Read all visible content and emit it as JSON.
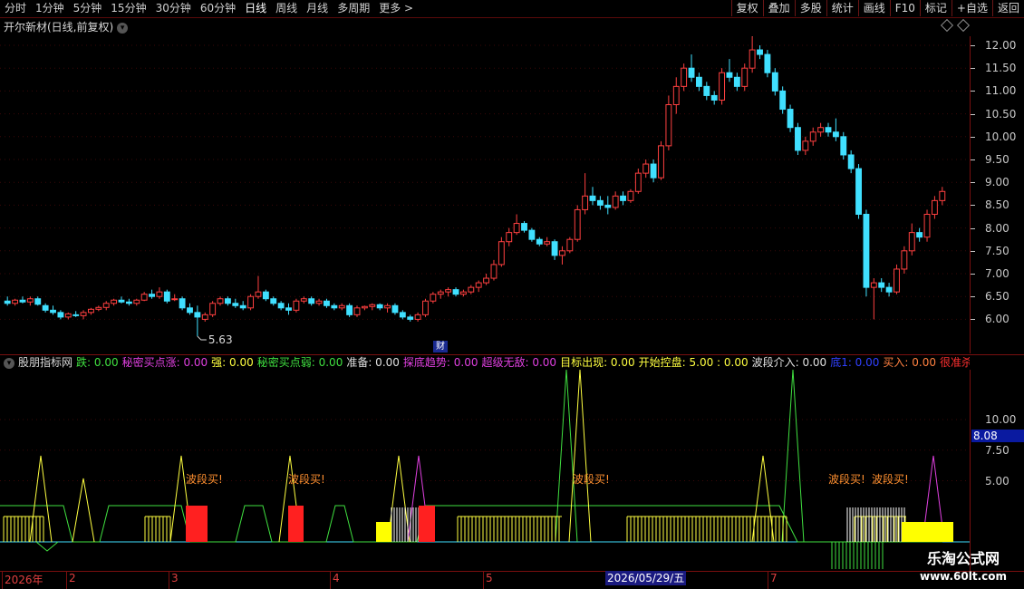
{
  "toolbar": {
    "periods": [
      "分时",
      "1分钟",
      "5分钟",
      "15分钟",
      "30分钟",
      "60分钟",
      "日线",
      "周线",
      "月线",
      "多周期",
      "更多 >"
    ],
    "active_period": "日线",
    "buttons": [
      "复权",
      "叠加",
      "多股",
      "统计",
      "画线",
      "F10",
      "标记",
      "+自选",
      "返回"
    ]
  },
  "title": "开尔新材(日线,前复权)",
  "price_axis": {
    "ticks": [
      "12.00",
      "11.50",
      "11.00",
      "10.50",
      "10.00",
      "9.50",
      "9.00",
      "8.50",
      "8.00",
      "7.50",
      "7.00",
      "6.50",
      "6.00"
    ],
    "values": [
      12.0,
      11.5,
      11.0,
      10.5,
      10.0,
      9.5,
      9.0,
      8.5,
      8.0,
      7.5,
      7.0,
      6.5,
      6.0
    ],
    "max_label": "12.20",
    "min_label": "5.63",
    "cai": "财"
  },
  "indicator": {
    "name": "股朋指标网",
    "items": [
      {
        "label": "跌",
        "value": "0.00",
        "color": "#40e040"
      },
      {
        "label": "秘密买点涨",
        "value": "0.00",
        "color": "#e040e0"
      },
      {
        "label": "强",
        "value": "0.00",
        "color": "#ffff40"
      },
      {
        "label": "秘密买点弱",
        "value": "0.00",
        "color": "#40e040"
      },
      {
        "label": "准备",
        "value": "0.00",
        "color": "#e0e0e0"
      },
      {
        "label": "探底趋势",
        "value": "0.00",
        "color": "#e040e0"
      },
      {
        "label": "超级无敌",
        "value": "0.00",
        "color": "#e040e0"
      },
      {
        "label": "目标出现",
        "value": "0.00",
        "color": "#ffff40"
      },
      {
        "label": "开始控盘",
        "value": "5.00",
        "extra": ": 0.00",
        "color": "#ffff40"
      },
      {
        "label": "波段介入",
        "value": "0.00",
        "color": "#e0e0e0"
      },
      {
        "label": "底1",
        "value": "0.00",
        "color": "#3040ff"
      },
      {
        "label": "买入",
        "value": "0.00",
        "color": "#ff8040"
      },
      {
        "label": "很准杀入",
        "value": "0.00",
        "color": "#ff3030"
      }
    ],
    "axis_ticks": [
      "10.00",
      "7.50",
      "5.00"
    ],
    "axis_values": [
      10.0,
      7.5,
      5.0
    ],
    "cursor_value": "8.08",
    "signal_label": "波段买!"
  },
  "dates": {
    "labels": [
      "2026年",
      "2",
      "3",
      "4",
      "5",
      "7"
    ],
    "cursor": "2026/05/29/五"
  },
  "watermark": {
    "line1": "乐淘公式网",
    "line2": "www.60lt.com"
  },
  "colors": {
    "up": "#ff4040",
    "down": "#40e0ff",
    "grid": "#7a0f0f",
    "bg": "#000000"
  },
  "chart_data": {
    "type": "candlestick",
    "ohlc": [
      [
        6.4,
        6.5,
        6.3,
        6.35
      ],
      [
        6.35,
        6.45,
        6.3,
        6.42
      ],
      [
        6.42,
        6.5,
        6.35,
        6.38
      ],
      [
        6.38,
        6.5,
        6.3,
        6.45
      ],
      [
        6.45,
        6.5,
        6.3,
        6.33
      ],
      [
        6.3,
        6.35,
        6.15,
        6.2
      ],
      [
        6.2,
        6.3,
        6.1,
        6.15
      ],
      [
        6.15,
        6.2,
        6.0,
        6.05
      ],
      [
        6.05,
        6.15,
        6.0,
        6.12
      ],
      [
        6.1,
        6.18,
        6.05,
        6.08
      ],
      [
        6.08,
        6.2,
        6.0,
        6.15
      ],
      [
        6.15,
        6.25,
        6.1,
        6.22
      ],
      [
        6.22,
        6.3,
        6.18,
        6.26
      ],
      [
        6.26,
        6.4,
        6.2,
        6.35
      ],
      [
        6.35,
        6.45,
        6.3,
        6.42
      ],
      [
        6.42,
        6.5,
        6.35,
        6.38
      ],
      [
        6.38,
        6.45,
        6.3,
        6.35
      ],
      [
        6.35,
        6.45,
        6.3,
        6.42
      ],
      [
        6.42,
        6.6,
        6.4,
        6.55
      ],
      [
        6.55,
        6.65,
        6.45,
        6.5
      ],
      [
        6.5,
        6.7,
        6.45,
        6.6
      ],
      [
        6.6,
        6.65,
        6.35,
        6.4
      ],
      [
        6.45,
        6.55,
        6.4,
        6.45
      ],
      [
        6.45,
        6.5,
        6.2,
        6.25
      ],
      [
        6.25,
        6.35,
        6.1,
        6.15
      ],
      [
        6.15,
        6.3,
        5.63,
        6.05
      ],
      [
        6.0,
        6.15,
        5.95,
        6.1
      ],
      [
        6.1,
        6.4,
        6.05,
        6.35
      ],
      [
        6.35,
        6.5,
        6.3,
        6.45
      ],
      [
        6.45,
        6.5,
        6.3,
        6.35
      ],
      [
        6.35,
        6.45,
        6.25,
        6.3
      ],
      [
        6.3,
        6.4,
        6.2,
        6.25
      ],
      [
        6.25,
        6.55,
        6.2,
        6.5
      ],
      [
        6.5,
        6.95,
        6.45,
        6.6
      ],
      [
        6.6,
        6.65,
        6.4,
        6.45
      ],
      [
        6.45,
        6.5,
        6.3,
        6.35
      ],
      [
        6.35,
        6.4,
        6.2,
        6.25
      ],
      [
        6.25,
        6.35,
        6.1,
        6.2
      ],
      [
        6.2,
        6.45,
        6.15,
        6.4
      ],
      [
        6.4,
        6.5,
        6.35,
        6.45
      ],
      [
        6.45,
        6.5,
        6.3,
        6.35
      ],
      [
        6.35,
        6.45,
        6.3,
        6.4
      ],
      [
        6.4,
        6.45,
        6.25,
        6.3
      ],
      [
        6.3,
        6.35,
        6.2,
        6.25
      ],
      [
        6.25,
        6.35,
        6.2,
        6.3
      ],
      [
        6.3,
        6.35,
        6.05,
        6.1
      ],
      [
        6.1,
        6.3,
        6.05,
        6.25
      ],
      [
        6.25,
        6.3,
        6.2,
        6.28
      ],
      [
        6.28,
        6.35,
        6.2,
        6.32
      ],
      [
        6.32,
        6.35,
        6.2,
        6.25
      ],
      [
        6.25,
        6.35,
        6.15,
        6.3
      ],
      [
        6.3,
        6.35,
        6.1,
        6.15
      ],
      [
        6.15,
        6.2,
        6.0,
        6.05
      ],
      [
        6.05,
        6.1,
        5.95,
        6.0
      ],
      [
        6.0,
        6.15,
        5.95,
        6.1
      ],
      [
        6.1,
        6.45,
        6.05,
        6.4
      ],
      [
        6.4,
        6.6,
        6.35,
        6.55
      ],
      [
        6.55,
        6.65,
        6.45,
        6.6
      ],
      [
        6.6,
        6.7,
        6.5,
        6.65
      ],
      [
        6.65,
        6.7,
        6.5,
        6.55
      ],
      [
        6.55,
        6.65,
        6.5,
        6.6
      ],
      [
        6.6,
        6.75,
        6.55,
        6.7
      ],
      [
        6.7,
        6.85,
        6.6,
        6.8
      ],
      [
        6.8,
        7.0,
        6.75,
        6.9
      ],
      [
        6.9,
        7.3,
        6.85,
        7.2
      ],
      [
        7.2,
        7.8,
        7.15,
        7.7
      ],
      [
        7.7,
        8.0,
        7.6,
        7.9
      ],
      [
        7.9,
        8.3,
        7.85,
        8.1
      ],
      [
        8.1,
        8.15,
        7.9,
        7.95
      ],
      [
        7.95,
        8.0,
        7.7,
        7.75
      ],
      [
        7.75,
        7.8,
        7.6,
        7.65
      ],
      [
        7.65,
        7.8,
        7.6,
        7.7
      ],
      [
        7.7,
        7.75,
        7.3,
        7.4
      ],
      [
        7.4,
        7.6,
        7.2,
        7.5
      ],
      [
        7.5,
        7.8,
        7.45,
        7.75
      ],
      [
        7.75,
        8.5,
        7.7,
        8.4
      ],
      [
        8.4,
        9.2,
        8.3,
        8.7
      ],
      [
        8.7,
        8.9,
        8.5,
        8.6
      ],
      [
        8.6,
        8.7,
        8.4,
        8.5
      ],
      [
        8.5,
        8.7,
        8.3,
        8.45
      ],
      [
        8.45,
        8.8,
        8.4,
        8.7
      ],
      [
        8.7,
        8.8,
        8.5,
        8.6
      ],
      [
        8.6,
        8.85,
        8.55,
        8.8
      ],
      [
        8.8,
        9.3,
        8.75,
        9.2
      ],
      [
        9.2,
        9.5,
        9.1,
        9.4
      ],
      [
        9.4,
        9.5,
        9.0,
        9.1
      ],
      [
        9.1,
        9.9,
        9.05,
        9.8
      ],
      [
        9.8,
        10.9,
        9.7,
        10.7
      ],
      [
        10.7,
        11.3,
        10.5,
        11.1
      ],
      [
        11.1,
        11.6,
        11.0,
        11.5
      ],
      [
        11.5,
        11.8,
        11.2,
        11.3
      ],
      [
        11.3,
        11.4,
        11.0,
        11.1
      ],
      [
        11.1,
        11.2,
        10.8,
        10.9
      ],
      [
        10.9,
        11.0,
        10.7,
        10.8
      ],
      [
        10.8,
        11.5,
        10.7,
        11.4
      ],
      [
        11.4,
        11.7,
        11.2,
        11.3
      ],
      [
        11.3,
        11.4,
        11.0,
        11.1
      ],
      [
        11.1,
        11.6,
        11.0,
        11.5
      ],
      [
        11.5,
        12.2,
        11.4,
        11.9
      ],
      [
        11.9,
        12.0,
        11.7,
        11.8
      ],
      [
        11.8,
        11.9,
        11.3,
        11.4
      ],
      [
        11.4,
        11.5,
        10.9,
        11.0
      ],
      [
        11.0,
        11.1,
        10.5,
        10.6
      ],
      [
        10.6,
        10.7,
        10.1,
        10.2
      ],
      [
        10.2,
        10.3,
        9.6,
        9.7
      ],
      [
        9.7,
        10.0,
        9.6,
        9.9
      ],
      [
        9.9,
        10.2,
        9.8,
        10.1
      ],
      [
        10.1,
        10.3,
        10.0,
        10.2
      ],
      [
        10.2,
        10.3,
        10.0,
        10.1
      ],
      [
        10.1,
        10.4,
        9.9,
        10.0
      ],
      [
        10.0,
        10.1,
        9.5,
        9.6
      ],
      [
        9.6,
        9.7,
        9.2,
        9.3
      ],
      [
        9.3,
        9.4,
        8.2,
        8.3
      ],
      [
        8.3,
        8.4,
        6.5,
        6.7
      ],
      [
        6.7,
        6.9,
        6.0,
        6.8
      ],
      [
        6.8,
        6.9,
        6.6,
        6.7
      ],
      [
        6.7,
        6.8,
        6.5,
        6.6
      ],
      [
        6.6,
        7.2,
        6.55,
        7.1
      ],
      [
        7.1,
        7.6,
        7.0,
        7.5
      ],
      [
        7.5,
        8.1,
        7.4,
        7.9
      ],
      [
        7.9,
        8.0,
        7.7,
        7.8
      ],
      [
        7.8,
        8.4,
        7.7,
        8.3
      ],
      [
        8.3,
        8.7,
        8.2,
        8.6
      ],
      [
        8.6,
        8.9,
        8.5,
        8.8
      ]
    ]
  }
}
